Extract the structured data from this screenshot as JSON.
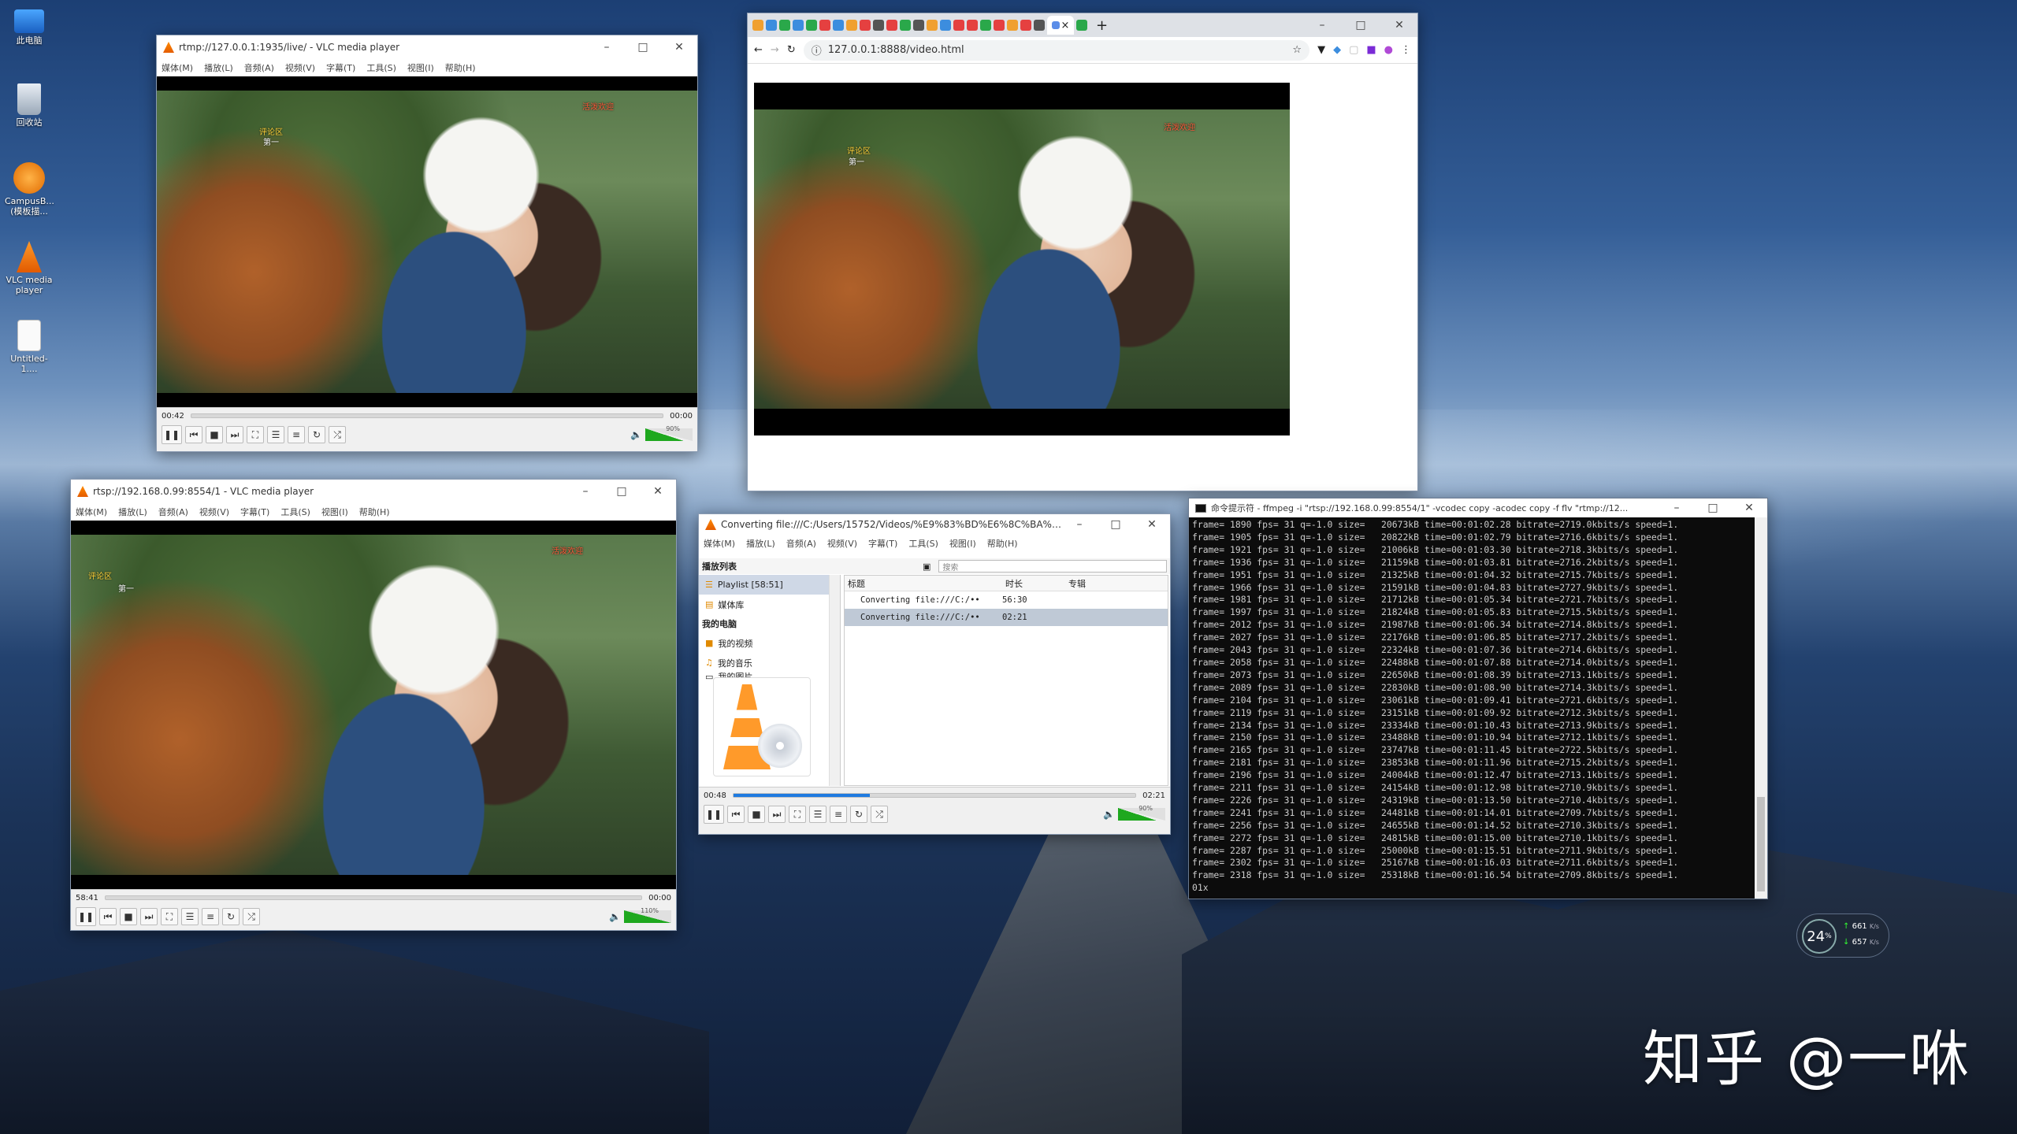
{
  "desktop_icons": [
    {
      "label": "此电脑",
      "icon": "computer-icon"
    },
    {
      "label": "回收站",
      "icon": "recycle-bin-icon"
    },
    {
      "label": "CampusB...(模板描...",
      "icon": "campus-icon"
    },
    {
      "label": "VLC media player",
      "icon": "vlc-icon"
    },
    {
      "label": "Untitled-1....",
      "icon": "document-icon"
    }
  ],
  "vlc1": {
    "title": "rtmp://127.0.0.1:1935/live/ - VLC media player",
    "menu": [
      "媒体(M)",
      "播放(L)",
      "音频(A)",
      "视频(V)",
      "字幕(T)",
      "工具(S)",
      "视图(I)",
      "帮助(H)"
    ],
    "time_current": "00:42",
    "time_total": "00:00",
    "volume": "90%",
    "progress": 0
  },
  "vlc2": {
    "title": "rtsp://192.168.0.99:8554/1 - VLC media player",
    "menu": [
      "媒体(M)",
      "播放(L)",
      "音频(A)",
      "视频(V)",
      "字幕(T)",
      "工具(S)",
      "视图(I)",
      "帮助(H)"
    ],
    "time_current": "58:41",
    "time_total": "00:00",
    "volume": "110%",
    "progress": 0
  },
  "chrome": {
    "url": "127.0.0.1:8888/video.html",
    "tab_close": "×",
    "new_tab": "+"
  },
  "vlc3": {
    "title": "Converting file:///C:/Users/15752/Videos/%E9%83%BD%E6%8C%BA%E5...",
    "menu": [
      "媒体(M)",
      "播放(L)",
      "音频(A)",
      "视频(V)",
      "字幕(T)",
      "工具(S)",
      "视图(I)",
      "帮助(H)"
    ],
    "sidebar_header": "播放列表",
    "search_placeholder": "搜索",
    "sidebar_items": [
      {
        "label": "Playlist [58:51]",
        "selected": true
      },
      {
        "label": "媒体库"
      }
    ],
    "mypc_header": "我的电脑",
    "mypc_items": [
      {
        "label": "我的视频"
      },
      {
        "label": "我的音乐"
      },
      {
        "label": "我的图片"
      }
    ],
    "columns": [
      "标题",
      "时长",
      "专辑"
    ],
    "rows": [
      {
        "title": "Converting file:///C:/••",
        "duration": "56:30"
      },
      {
        "title": "Converting file:///C:/••",
        "duration": "02:21"
      }
    ],
    "time_current": "00:48",
    "time_total": "02:21",
    "volume": "90%",
    "progress": 0.34
  },
  "cmd": {
    "title": "命令提示符 - ffmpeg  -i \"rtsp://192.168.0.99:8554/1\" -vcodec copy -acodec copy -f flv \"rtmp://12...",
    "lines": [
      "frame= 1890 fps= 31 q=-1.0 size=   20673kB time=00:01:02.28 bitrate=2719.0kbits/s speed=1.",
      "frame= 1905 fps= 31 q=-1.0 size=   20822kB time=00:01:02.79 bitrate=2716.6kbits/s speed=1.",
      "frame= 1921 fps= 31 q=-1.0 size=   21006kB time=00:01:03.30 bitrate=2718.3kbits/s speed=1.",
      "frame= 1936 fps= 31 q=-1.0 size=   21159kB time=00:01:03.81 bitrate=2716.2kbits/s speed=1.",
      "frame= 1951 fps= 31 q=-1.0 size=   21325kB time=00:01:04.32 bitrate=2715.7kbits/s speed=1.",
      "frame= 1966 fps= 31 q=-1.0 size=   21591kB time=00:01:04.83 bitrate=2727.9kbits/s speed=1.",
      "frame= 1981 fps= 31 q=-1.0 size=   21712kB time=00:01:05.34 bitrate=2721.7kbits/s speed=1.",
      "frame= 1997 fps= 31 q=-1.0 size=   21824kB time=00:01:05.83 bitrate=2715.5kbits/s speed=1.",
      "frame= 2012 fps= 31 q=-1.0 size=   21987kB time=00:01:06.34 bitrate=2714.8kbits/s speed=1.",
      "frame= 2027 fps= 31 q=-1.0 size=   22176kB time=00:01:06.85 bitrate=2717.2kbits/s speed=1.",
      "frame= 2043 fps= 31 q=-1.0 size=   22324kB time=00:01:07.36 bitrate=2714.6kbits/s speed=1.",
      "frame= 2058 fps= 31 q=-1.0 size=   22488kB time=00:01:07.88 bitrate=2714.0kbits/s speed=1.",
      "frame= 2073 fps= 31 q=-1.0 size=   22650kB time=00:01:08.39 bitrate=2713.1kbits/s speed=1.",
      "frame= 2089 fps= 31 q=-1.0 size=   22830kB time=00:01:08.90 bitrate=2714.3kbits/s speed=1.",
      "frame= 2104 fps= 31 q=-1.0 size=   23061kB time=00:01:09.41 bitrate=2721.6kbits/s speed=1.",
      "frame= 2119 fps= 31 q=-1.0 size=   23151kB time=00:01:09.92 bitrate=2712.3kbits/s speed=1.",
      "frame= 2134 fps= 31 q=-1.0 size=   23334kB time=00:01:10.43 bitrate=2713.9kbits/s speed=1.",
      "frame= 2150 fps= 31 q=-1.0 size=   23488kB time=00:01:10.94 bitrate=2712.1kbits/s speed=1.",
      "frame= 2165 fps= 31 q=-1.0 size=   23747kB time=00:01:11.45 bitrate=2722.5kbits/s speed=1.",
      "frame= 2181 fps= 31 q=-1.0 size=   23853kB time=00:01:11.96 bitrate=2715.2kbits/s speed=1.",
      "frame= 2196 fps= 31 q=-1.0 size=   24004kB time=00:01:12.47 bitrate=2713.1kbits/s speed=1.",
      "frame= 2211 fps= 31 q=-1.0 size=   24154kB time=00:01:12.98 bitrate=2710.9kbits/s speed=1.",
      "frame= 2226 fps= 31 q=-1.0 size=   24319kB time=00:01:13.50 bitrate=2710.4kbits/s speed=1.",
      "frame= 2241 fps= 31 q=-1.0 size=   24481kB time=00:01:14.01 bitrate=2709.7kbits/s speed=1.",
      "frame= 2256 fps= 31 q=-1.0 size=   24655kB time=00:01:14.52 bitrate=2710.3kbits/s speed=1.",
      "frame= 2272 fps= 31 q=-1.0 size=   24815kB time=00:01:15.00 bitrate=2710.1kbits/s speed=1.",
      "frame= 2287 fps= 31 q=-1.0 size=   25000kB time=00:01:15.51 bitrate=2711.9kbits/s speed=1.",
      "frame= 2302 fps= 31 q=-1.0 size=   25167kB time=00:01:16.03 bitrate=2711.6kbits/s speed=1.",
      "frame= 2318 fps= 31 q=-1.0 size=   25318kB time=00:01:16.54 bitrate=2709.8kbits/s speed=1.",
      "01x"
    ]
  },
  "netmon": {
    "cpu": "24",
    "cpu_unit": "%",
    "up": "661",
    "down": "657",
    "unit": "K/s"
  },
  "watermark": "知乎 @一咻",
  "danmu": [
    "活泼欢迎",
    "评论区",
    "第一"
  ]
}
